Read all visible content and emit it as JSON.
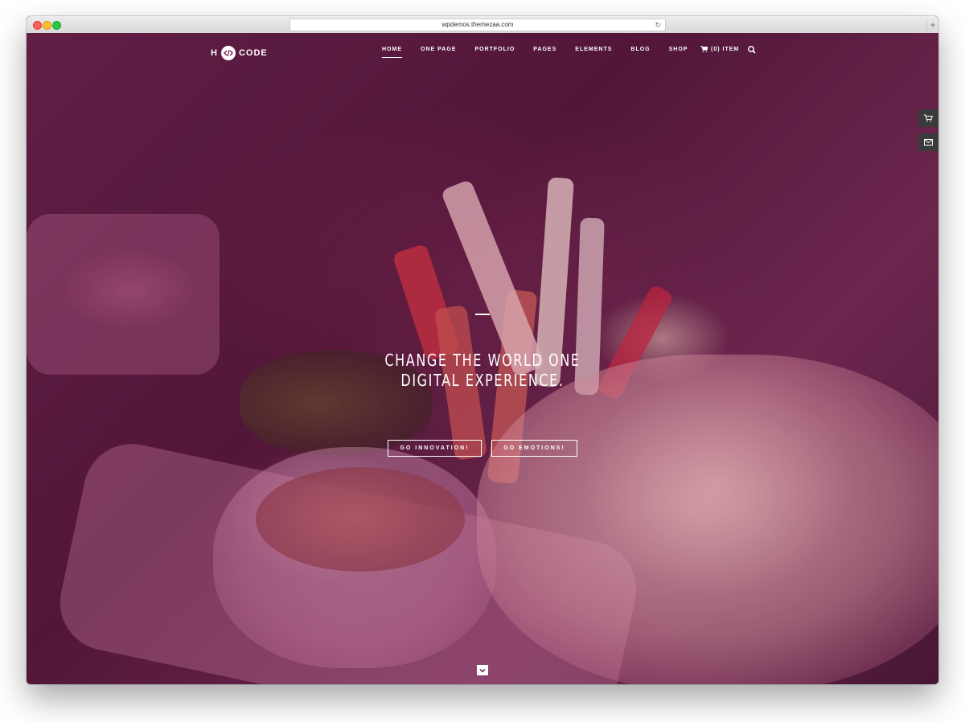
{
  "browser": {
    "url": "wpdemos.themezaa.com",
    "reload_icon": "reload-icon",
    "new_tab_icon": "plus-icon"
  },
  "brand": {
    "logo_left": "H",
    "logo_right": "CODE",
    "logo_icon": "code-brackets-icon"
  },
  "nav": {
    "items": [
      "HOME",
      "ONE PAGE",
      "PORTFOLIO",
      "PAGES",
      "ELEMENTS",
      "BLOG",
      "SHOP"
    ],
    "active": "HOME",
    "cart_label": "(0) ITEM",
    "cart_icon": "cart-icon",
    "search_icon": "search-icon"
  },
  "side_buttons": [
    "cart-icon",
    "mail-icon"
  ],
  "hero": {
    "headline_line1": "CHANGE THE WORLD ONE",
    "headline_line2": "DIGITAL EXPERIENCE.",
    "cta_primary": "GO INNOVATION!",
    "cta_secondary": "GO EMOTIONS!",
    "scroll_icon": "chevron-down-icon"
  },
  "colors": {
    "overlay": "#7a1e50",
    "accent": "#ffffff"
  }
}
